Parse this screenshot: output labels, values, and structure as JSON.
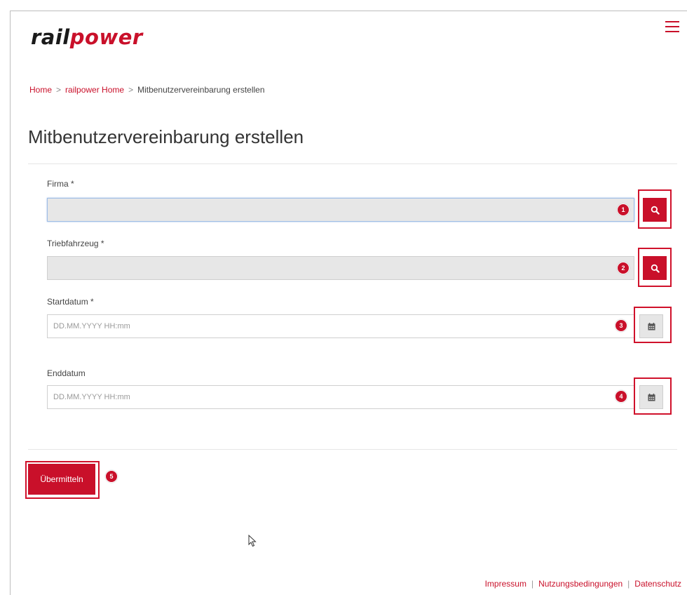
{
  "brand": {
    "logo_part1": "rail",
    "logo_part2": "power"
  },
  "breadcrumb": {
    "items": [
      "Home",
      "railpower Home",
      "Mitbenutzervereinbarung erstellen"
    ],
    "separator": ">"
  },
  "page": {
    "title": "Mitbenutzervereinbarung erstellen"
  },
  "form": {
    "firma": {
      "label": "Firma *",
      "value": "",
      "step": "1"
    },
    "triebfahrzeug": {
      "label": "Triebfahrzeug *",
      "value": "",
      "step": "2"
    },
    "startdatum": {
      "label": "Startdatum *",
      "placeholder": "DD.MM.YYYY HH:mm",
      "step": "3"
    },
    "enddatum": {
      "label": "Enddatum",
      "placeholder": "DD.MM.YYYY HH:mm",
      "step": "4"
    },
    "submit": {
      "label": "Übermitteln",
      "step": "5"
    }
  },
  "footer": {
    "links": [
      "Impressum",
      "Nutzungsbedingungen",
      "Datenschutz"
    ]
  },
  "colors": {
    "accent": "#c9102a",
    "highlight": "#d0112b",
    "input_grey": "#e7e7e7"
  },
  "icons": [
    "menu-icon",
    "search-icon",
    "calendar-icon",
    "cursor-icon"
  ]
}
